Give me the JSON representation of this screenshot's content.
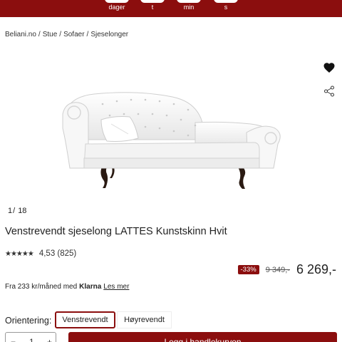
{
  "countdown": {
    "labels": [
      "dager",
      "t",
      "min",
      "s"
    ]
  },
  "breadcrumb": {
    "items": [
      "Beliani.no",
      "Stue",
      "Sofaer",
      "Sjeselonger"
    ],
    "separator": "/"
  },
  "gallery": {
    "current": "1",
    "separator": "/",
    "total": "18"
  },
  "product": {
    "title": "Venstrevendt sjeselong LATTES Kunstskinn Hvit",
    "rating_stars": "★★★★★",
    "rating_value": 4.53,
    "rating_text": "4,53 (825)",
    "discount": "-33%",
    "old_price": "9 349,-",
    "price": "6 269,-"
  },
  "financing": {
    "text": "Fra 233 kr/måned med",
    "brand": "Klarna",
    "link": "Les mer"
  },
  "orientation": {
    "label": "Orientering:",
    "options": [
      "Venstrevendt",
      "Høyrevendt"
    ],
    "selected": "Venstrevendt"
  },
  "quantity": {
    "minus": "−",
    "value": "1",
    "plus": "+"
  },
  "cart_button": "Legg i handlekurven",
  "icons": {
    "wishlist": "heart-icon",
    "share": "share-icon"
  },
  "colors": {
    "brand": "#8b0e0e",
    "text": "#222222"
  }
}
